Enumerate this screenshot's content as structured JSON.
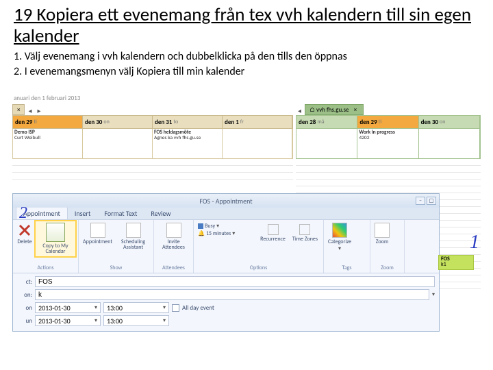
{
  "title": "19 Kopiera ett evenemang från tex vvh kalendern till sin egen kalender",
  "steps": [
    "1. Välj evenemang i vvh kalendern och dubbelklicka på den tills den öppnas",
    "2. I evenemangsmenyn välj Kopiera till min kalender"
  ],
  "left_cal": {
    "header": "anuari   den 1 februari 2013",
    "tab_close": "×",
    "days": [
      {
        "num": "den 29",
        "wd": "ti"
      },
      {
        "num": "den 30",
        "wd": "on"
      },
      {
        "num": "den 31",
        "wd": "to"
      },
      {
        "num": "den 1",
        "wd": "fr"
      }
    ],
    "events": [
      {
        "title": "Demo ISP",
        "sub": "Curt Weibull"
      },
      {
        "title": "",
        "sub": ""
      },
      {
        "title": "FOS heldagsmöte",
        "sub": "Agnes ka vvh fhs.gu.se"
      },
      {
        "title": "",
        "sub": ""
      }
    ]
  },
  "right_cal": {
    "tab_home": "⌂",
    "tab_label": "vvh fhs.gu.se",
    "tab_close": "×",
    "days": [
      {
        "num": "den 28",
        "wd": "må"
      },
      {
        "num": "den 29",
        "wd": "ti"
      },
      {
        "num": "den 30",
        "wd": "on"
      }
    ],
    "events": [
      {
        "title": "",
        "sub": ""
      },
      {
        "title": "Work in progress",
        "sub": "4202"
      },
      {
        "title": "",
        "sub": ""
      }
    ]
  },
  "appt": {
    "window_title": "FOS - Appointment",
    "tabs": [
      "Appointment",
      "Insert",
      "Format Text",
      "Review"
    ],
    "groups": {
      "actions": {
        "label": "Actions",
        "delete": "Delete",
        "copy": "Copy to My Calendar"
      },
      "show": {
        "label": "Show",
        "appointment": "Appointment",
        "scheduling": "Scheduling Assistant"
      },
      "attendees": {
        "label": "Attendees",
        "invite": "Invite Attendees"
      },
      "options": {
        "label": "Options",
        "busy": "Busy",
        "reminder": "15 minutes",
        "recurrence": "Recurrence",
        "timezones": "Time Zones"
      },
      "tags": {
        "label": "Tags",
        "categorize": "Categorize"
      },
      "zoom": {
        "label": "Zoom",
        "zoom": "Zoom"
      }
    },
    "fields": {
      "subject_label": "ct:",
      "subject_value": "FOS",
      "location_label": "on:",
      "location_value": "k",
      "start_label": "on",
      "start_date": "2013-01-30",
      "start_time": "13:00",
      "end_label": "un",
      "end_date": "2013-01-30",
      "end_time": "13:00",
      "allday": "All day event"
    }
  },
  "annot": {
    "one": "1",
    "two": "2"
  },
  "sticky": {
    "l1": "FOS",
    "l2": "k1"
  }
}
